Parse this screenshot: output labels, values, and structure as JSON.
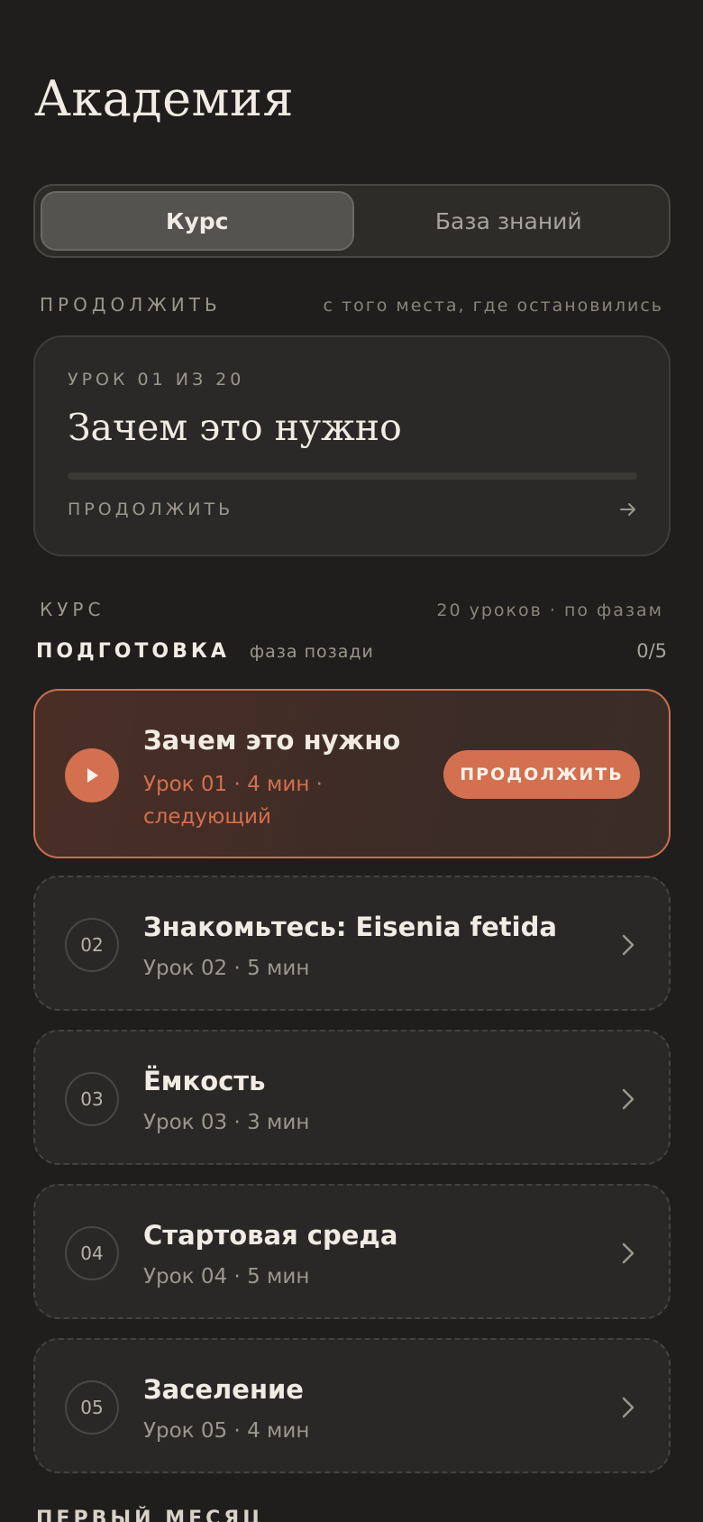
{
  "header": {
    "title": "Академия"
  },
  "tabs": [
    {
      "label": "Курс",
      "active": true
    },
    {
      "label": "База знаний",
      "active": false
    }
  ],
  "continue_section": {
    "kicker": "ПРОДОЛЖИТЬ",
    "note": "с того места, где остановились",
    "card": {
      "lesson_label": "УРОК 01 ИЗ 20",
      "title": "Зачем это нужно",
      "progress": 0,
      "action_label": "ПРОДОЛЖИТЬ"
    }
  },
  "course_section": {
    "kicker": "КУРС",
    "note": "20 уроков · по фазам"
  },
  "phase": {
    "name": "ПОДГОТОВКА",
    "note": "фаза позади",
    "count": "0/5"
  },
  "lessons": [
    {
      "number": "01",
      "title": "Зачем это нужно",
      "meta": "Урок 01 · 4 мин · следующий",
      "current": true,
      "button": "ПРОДОЛЖИТЬ"
    },
    {
      "number": "02",
      "title": "Знакомьтесь: Eisenia fetida",
      "meta": "Урок 02 · 5 мин"
    },
    {
      "number": "03",
      "title": "Ёмкость",
      "meta": "Урок 03 · 3 мин"
    },
    {
      "number": "04",
      "title": "Стартовая среда",
      "meta": "Урок 04 · 5 мин"
    },
    {
      "number": "05",
      "title": "Заселение",
      "meta": "Урок 05 · 4 мин"
    }
  ],
  "next_phase": {
    "name": "ПЕРВЫЙ МЕСЯЦ"
  },
  "colors": {
    "accent": "#d3704f",
    "background": "#1f1e1c",
    "card": "#292826"
  }
}
